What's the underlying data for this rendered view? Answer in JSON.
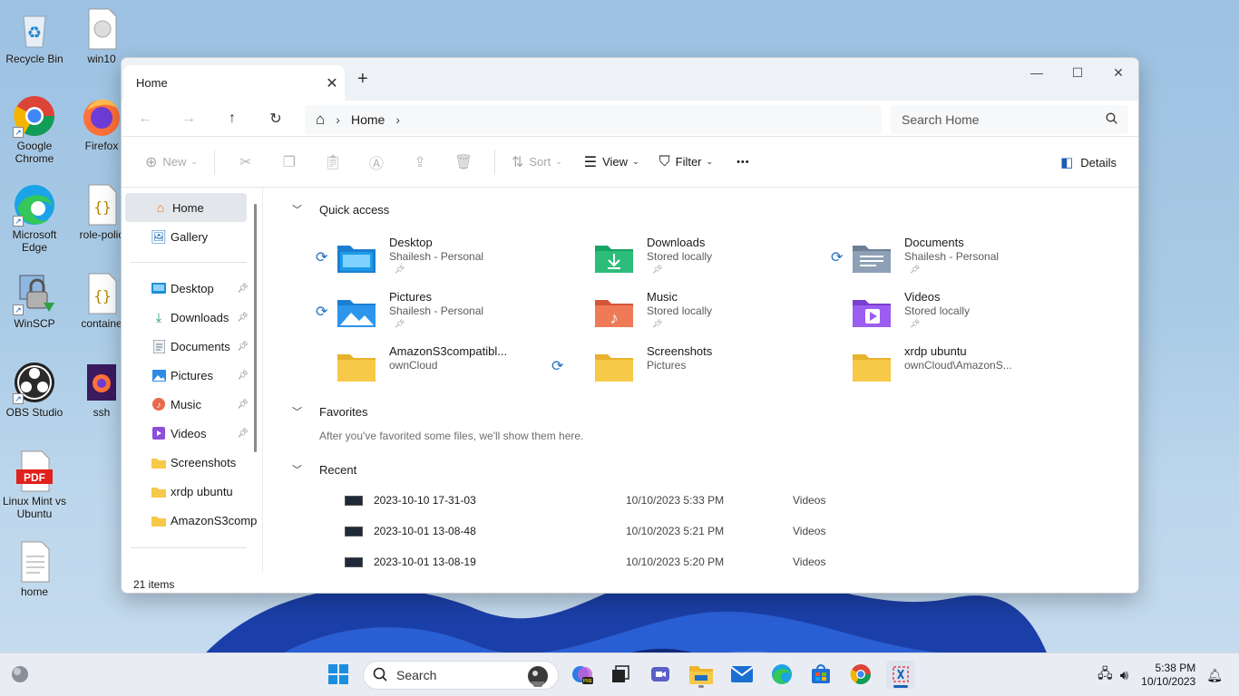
{
  "desktop": {
    "icons": [
      {
        "label": "Recycle Bin"
      },
      {
        "label": "win10"
      },
      {
        "label": "Google Chrome"
      },
      {
        "label": "Firefox"
      },
      {
        "label": "Microsoft Edge"
      },
      {
        "label": "role-polic"
      },
      {
        "label": "WinSCP"
      },
      {
        "label": "containe"
      },
      {
        "label": "OBS Studio"
      },
      {
        "label": "ssh"
      },
      {
        "label": "Linux Mint vs Ubuntu"
      },
      {
        "label": "home"
      }
    ]
  },
  "window": {
    "tab_title": "Home",
    "tab_close": "✕",
    "new_tab": "+",
    "controls": {
      "minimize": "—",
      "maximize": "☐",
      "close": "✕"
    },
    "nav": {
      "back": "←",
      "forward": "→",
      "up": "↑",
      "refresh": "↻"
    },
    "address": {
      "home_glyph": "⌂",
      "sep": "›",
      "crumb": "Home"
    },
    "search_placeholder": "Search Home",
    "commands": {
      "new": "New",
      "sort": "Sort",
      "view": "View",
      "filter": "Filter",
      "more": "•••",
      "details": "Details"
    },
    "sidebar": {
      "top": [
        {
          "label": "Home"
        },
        {
          "label": "Gallery"
        }
      ],
      "pinned": [
        {
          "label": "Desktop"
        },
        {
          "label": "Downloads"
        },
        {
          "label": "Documents"
        },
        {
          "label": "Pictures"
        },
        {
          "label": "Music"
        },
        {
          "label": "Videos"
        },
        {
          "label": "Screenshots"
        },
        {
          "label": "xrdp ubuntu"
        },
        {
          "label": "AmazonS3comp"
        }
      ]
    },
    "quick_access": {
      "title": "Quick access",
      "items": [
        {
          "name": "Desktop",
          "sub": "Shailesh - Personal"
        },
        {
          "name": "Downloads",
          "sub": "Stored locally"
        },
        {
          "name": "Documents",
          "sub": "Shailesh - Personal"
        },
        {
          "name": "Pictures",
          "sub": "Shailesh - Personal"
        },
        {
          "name": "Music",
          "sub": "Stored locally"
        },
        {
          "name": "Videos",
          "sub": "Stored locally"
        },
        {
          "name": "AmazonS3compatibl...",
          "sub": "ownCloud"
        },
        {
          "name": "Screenshots",
          "sub": "Pictures"
        },
        {
          "name": "xrdp ubuntu",
          "sub": "ownCloud\\AmazonS..."
        }
      ]
    },
    "favorites": {
      "title": "Favorites",
      "empty": "After you've favorited some files, we'll show them here."
    },
    "recent": {
      "title": "Recent",
      "rows": [
        {
          "name": "2023-10-10 17-31-03",
          "date": "10/10/2023 5:33 PM",
          "location": "Videos"
        },
        {
          "name": "2023-10-01 13-08-48",
          "date": "10/10/2023 5:21 PM",
          "location": "Videos"
        },
        {
          "name": "2023-10-01 13-08-19",
          "date": "10/10/2023 5:20 PM",
          "location": "Videos"
        }
      ]
    },
    "status": "21 items"
  },
  "taskbar": {
    "search": "Search",
    "time": "5:38 PM",
    "date": "10/10/2023"
  },
  "colors": {
    "accent": "#1a5fb4",
    "folder_yellow": "#f7c948",
    "sync_blue": "#1f6fc2"
  }
}
